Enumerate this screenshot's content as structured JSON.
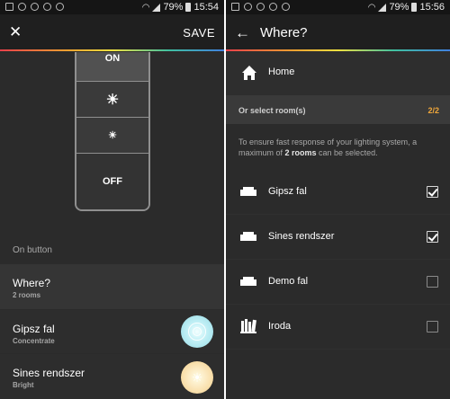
{
  "left": {
    "status": {
      "battery": "79%",
      "time": "15:54"
    },
    "header": {
      "close_icon": "close-icon",
      "save_label": "SAVE"
    },
    "switch": {
      "on_label": "ON",
      "off_label": "OFF",
      "bright_icon": "sun-large-icon",
      "dim_icon": "sun-small-icon"
    },
    "section_label": "On button",
    "where": {
      "title": "Where?",
      "subtitle": "2 rooms"
    },
    "rows": [
      {
        "title": "Gipsz fal",
        "subtitle": "Concentrate"
      },
      {
        "title": "Sines rendszer",
        "subtitle": "Bright"
      }
    ]
  },
  "right": {
    "status": {
      "battery": "79%",
      "time": "15:56"
    },
    "header": {
      "back_icon": "arrow-left-icon",
      "title": "Where?"
    },
    "home_label": "Home",
    "select_label": "Or select room(s)",
    "select_count": "2/2",
    "info_pre": "To ensure fast response of your lighting system, a maximum of ",
    "info_bold": "2 rooms",
    "info_post": " can be selected.",
    "rooms": [
      {
        "label": "Gipsz fal",
        "icon": "sofa-icon",
        "checked": true
      },
      {
        "label": "Sines rendszer",
        "icon": "sofa-icon",
        "checked": true
      },
      {
        "label": "Demo fal",
        "icon": "sofa-icon",
        "checked": false
      },
      {
        "label": "Iroda",
        "icon": "bookshelf-icon",
        "checked": false
      }
    ]
  },
  "colors": {
    "accent_orange": "#f0a73a",
    "background": "#2b2b2b"
  }
}
